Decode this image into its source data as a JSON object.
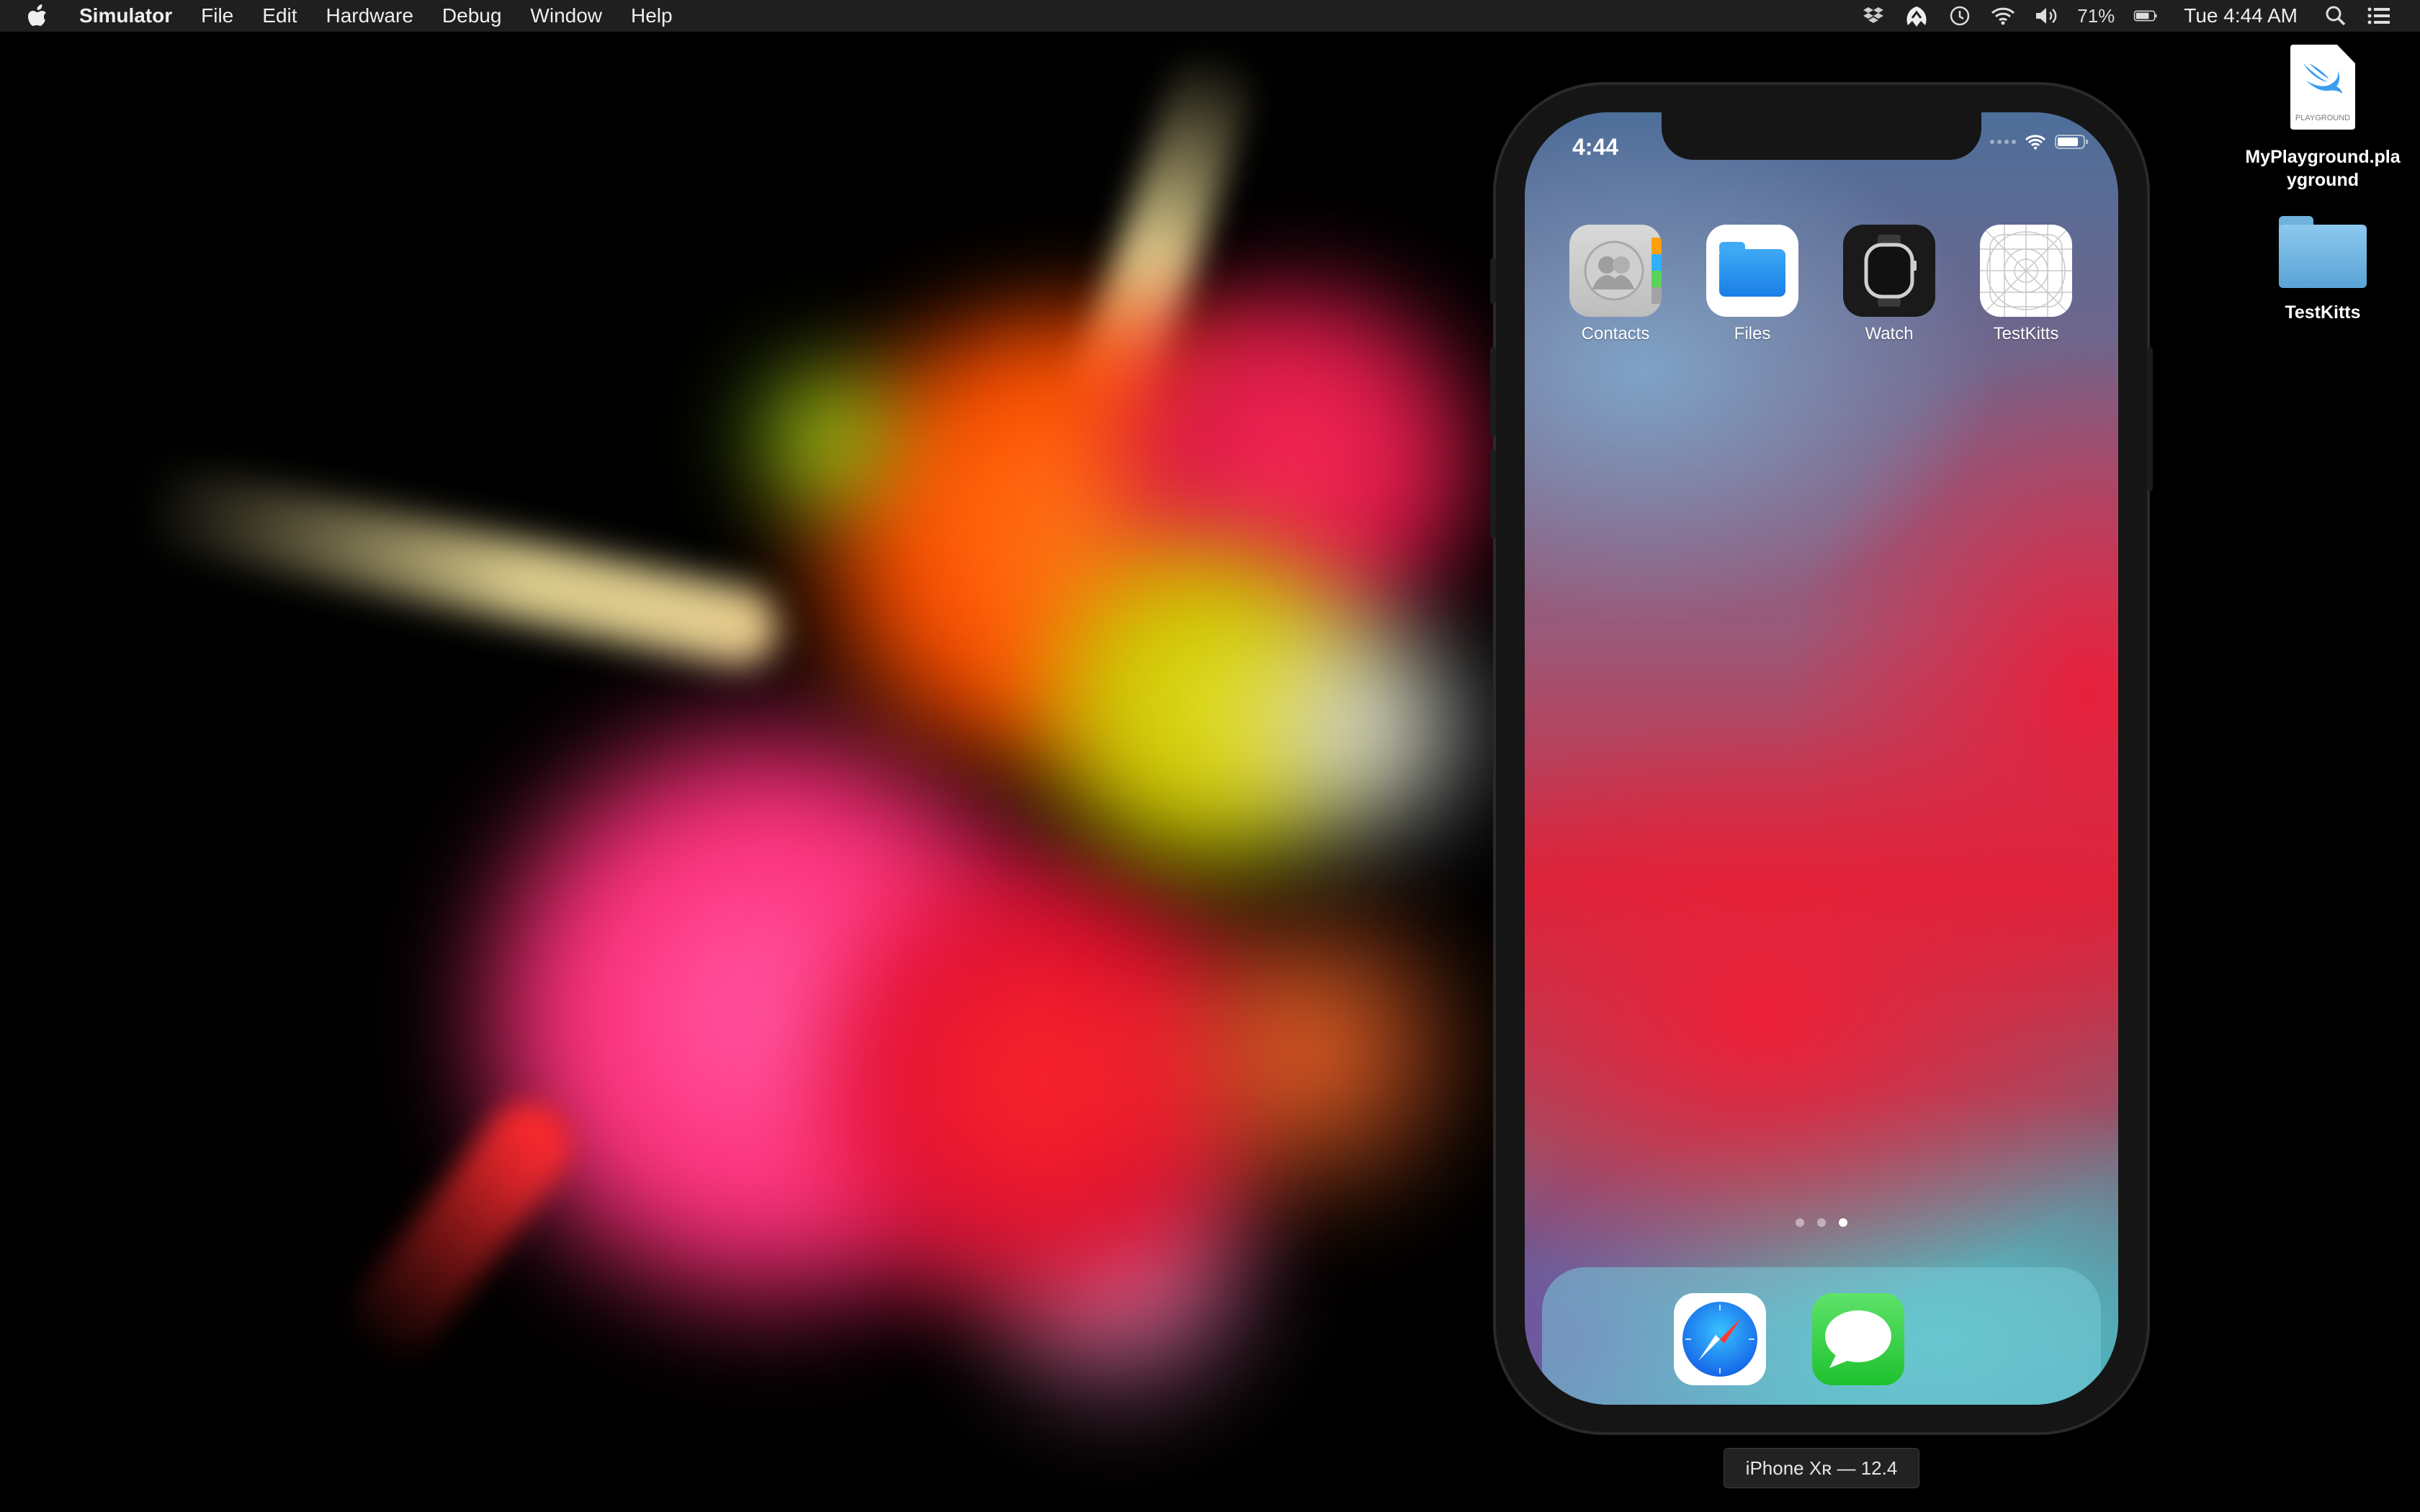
{
  "menubar": {
    "apple_icon": "apple-logo-icon",
    "app_name": "Simulator",
    "items": [
      "File",
      "Edit",
      "Hardware",
      "Debug",
      "Window",
      "Help"
    ],
    "status_icons": [
      "dropbox-icon",
      "malwarebytes-icon",
      "time-machine-icon",
      "wifi-icon",
      "volume-icon"
    ],
    "battery_percent": "71%",
    "clock": "Tue 4:44 AM"
  },
  "desktop": {
    "icons": [
      {
        "label": "MyPlayground.playground",
        "label_lines": [
          "MyPlayground.pla",
          "yground"
        ],
        "doc_caption": "PLAYGROUND",
        "icon": "swift-playground-icon"
      },
      {
        "label": "TestKitts",
        "icon": "folder-icon"
      }
    ]
  },
  "simulator": {
    "status_bar": {
      "time": "4:44"
    },
    "apps": [
      {
        "label": "Contacts",
        "icon": "contacts-icon"
      },
      {
        "label": "Files",
        "icon": "files-icon"
      },
      {
        "label": "Watch",
        "icon": "watch-icon"
      },
      {
        "label": "TestKitts",
        "icon": "blank-app-icon"
      }
    ],
    "page_indicator": {
      "pages": 3,
      "current": 3
    },
    "dock": [
      {
        "label": "Safari",
        "icon": "safari-icon"
      },
      {
        "label": "Messages",
        "icon": "messages-icon"
      }
    ],
    "device_name": "iPhone Xʀ — 12.4"
  },
  "colors": {
    "menubar_bg": "#1f1f1f",
    "messages_green": "#1ec12f",
    "files_blue": "#1a7ee6"
  }
}
